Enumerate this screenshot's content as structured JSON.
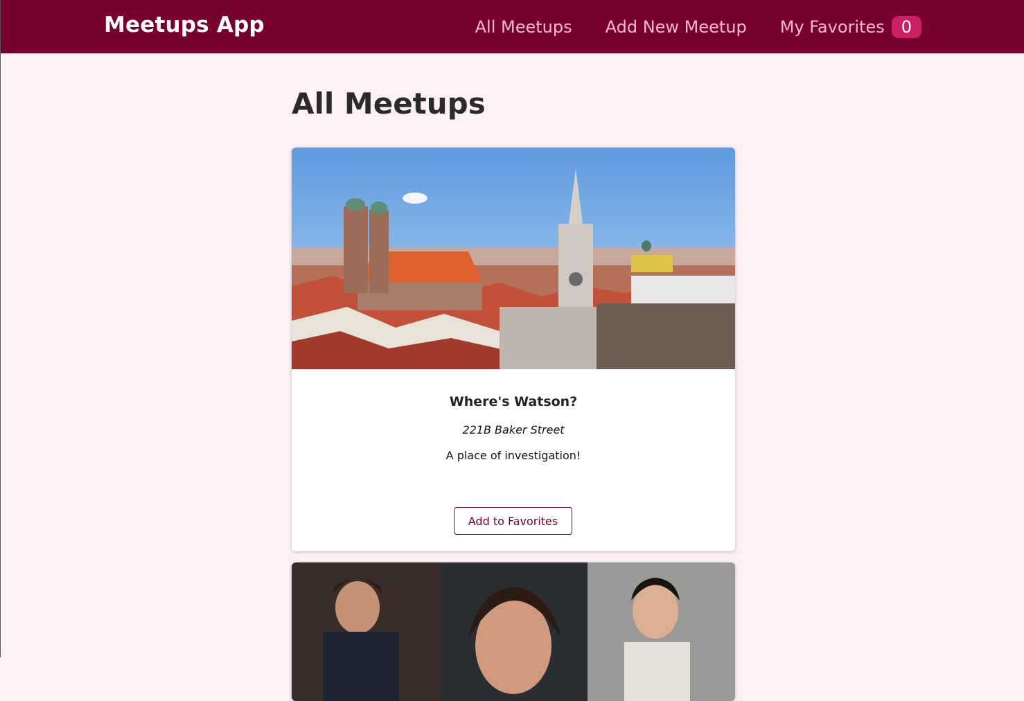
{
  "header": {
    "logo": "Meetups App",
    "nav": {
      "all": "All Meetups",
      "add": "Add New Meetup",
      "favorites": "My Favorites",
      "favorites_count": "0"
    }
  },
  "main": {
    "title": "All Meetups",
    "meetups": [
      {
        "title": "Where's Watson?",
        "address": "221B Baker Street",
        "description": "A place of investigation!",
        "button_label": "Add to Favorites"
      }
    ]
  },
  "colors": {
    "header_bg": "#77002e",
    "nav_link": "#fcb8d2",
    "badge_bg": "#cc2062",
    "page_bg": "#fdf1f5"
  }
}
